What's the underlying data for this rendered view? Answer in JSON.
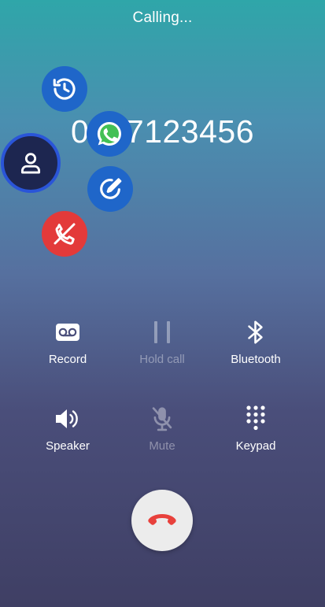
{
  "call": {
    "status": "Calling...",
    "number": "0507123456"
  },
  "bubbles": [
    {
      "icon": "history-icon"
    },
    {
      "icon": "whatsapp-icon"
    },
    {
      "icon": "contact-icon"
    },
    {
      "icon": "note-icon"
    },
    {
      "icon": "block-call-icon"
    }
  ],
  "controls": {
    "record": {
      "label": "Record",
      "icon": "voicemail-icon",
      "enabled": true
    },
    "hold": {
      "label": "Hold call",
      "icon": "pause-icon",
      "enabled": false
    },
    "bluetooth": {
      "label": "Bluetooth",
      "icon": "bluetooth-icon",
      "enabled": true
    },
    "speaker": {
      "label": "Speaker",
      "icon": "speaker-icon",
      "enabled": true
    },
    "mute": {
      "label": "Mute",
      "icon": "mic-off-icon",
      "enabled": false
    },
    "keypad": {
      "label": "Keypad",
      "icon": "dialpad-icon",
      "enabled": true
    }
  },
  "end_call": {
    "icon": "end-call-icon"
  },
  "colors": {
    "accent_blue": "#1f66c9",
    "danger_red": "#e33a3a",
    "end_call_icon": "#e8413c"
  }
}
